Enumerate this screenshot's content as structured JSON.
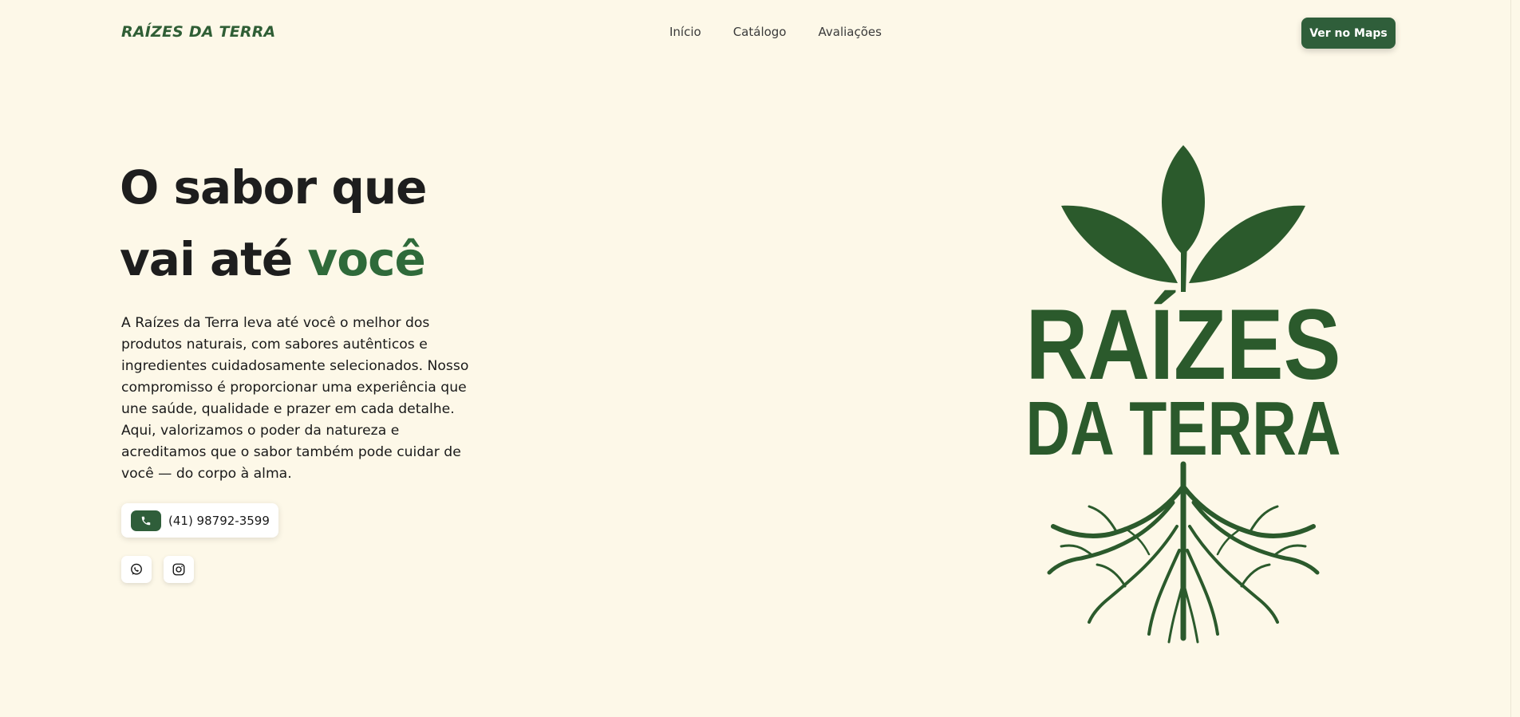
{
  "nav": {
    "brand": "RAÍZES DA TERRA",
    "links": [
      "Início",
      "Catálogo",
      "Avaliações"
    ],
    "cta": "Ver no Maps"
  },
  "hero": {
    "title_line1": "O sabor que",
    "title_line2_prefix": "vai até ",
    "title_line2_accent": "você",
    "description": "A Raízes da Terra leva até você o melhor dos produtos naturais, com sabores autênticos e ingredientes cuidadosamente selecionados. Nosso compromisso é proporcionar uma experiência que une saúde, qualidade e prazer em cada detalhe. Aqui, valorizamos o poder da natureza e acreditamos que o sabor também pode cuidar de você — do corpo à alma.",
    "phone": "(41) 98792-3599",
    "phone_icon": "phone-icon",
    "socials": [
      "whatsapp-icon",
      "instagram-icon"
    ]
  },
  "logo": {
    "line1": "RAÍZES",
    "line2": "DA TERRA"
  },
  "colors": {
    "background": "#fdf8e8",
    "brand_green": "#2f5e3a",
    "logo_green": "#2b5a2c",
    "text": "#1e1e1e"
  }
}
